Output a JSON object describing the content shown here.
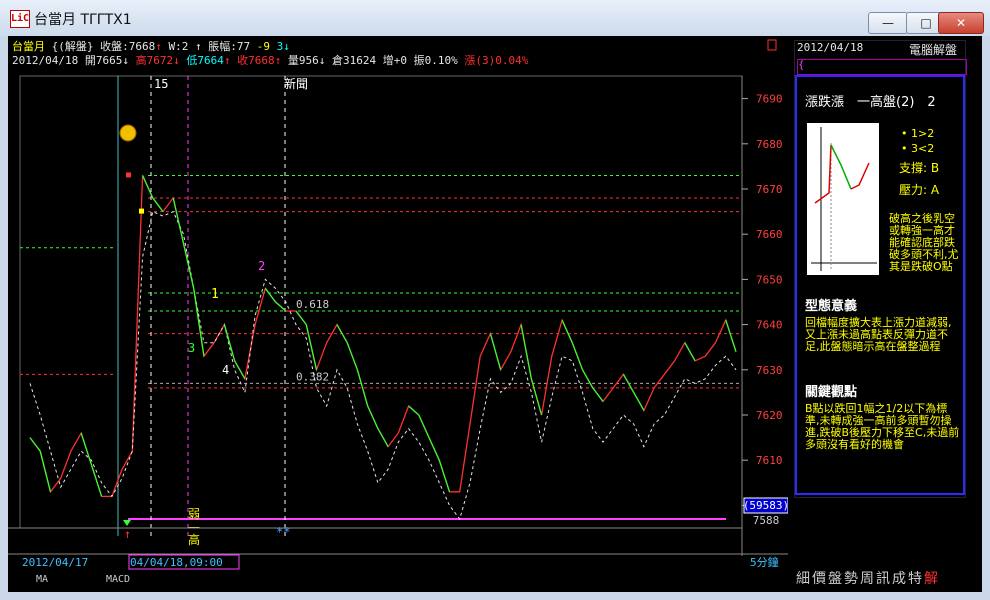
{
  "window": {
    "title": "台當月 TΓΓTX1",
    "icon_text": "LiC",
    "minimize_glyph": "—",
    "maximize_glyph": "□",
    "close_glyph": "✕"
  },
  "header": {
    "line1": {
      "name": "台當月",
      "mode": "{(解盤}",
      "close_label": "收盤:",
      "close_value": "7668",
      "arrow_up": "↑",
      "w_label": "W:",
      "w_value": "2",
      "amp_label": "↑ 脹幅:",
      "amp_value": "77",
      "change": "-9",
      "change_count": "3",
      "arrow_down": "↓"
    },
    "line2": {
      "date": "2012/04/18",
      "open": "開7665",
      "open_arrow": "↓",
      "high": "高7672",
      "high_arrow": "↓",
      "low": "低7664",
      "low_arrow": "↑",
      "close": "收7668",
      "close_arrow": "↑",
      "vol": "量956",
      "vol_arrow": "↓",
      "oi": "倉31624",
      "inc": "增+0",
      "amp": "振0.10%",
      "rise": "漲(3)0.04%"
    }
  },
  "chart_data": {
    "type": "line",
    "ylim": [
      7595,
      7695
    ],
    "yticks": [
      7600,
      7610,
      7620,
      7630,
      7640,
      7650,
      7660,
      7670,
      7680,
      7690
    ],
    "xlabels": {
      "left_date": "2012/04/17",
      "cursor_date": "04/04/18,09:00",
      "period": "5分鐘"
    },
    "series": [
      {
        "color": "#ff3030",
        "values": [
          7615,
          7612,
          7603,
          7606,
          7612,
          7616,
          7609,
          7602,
          7602,
          7608,
          7612,
          7673,
          7668,
          7665,
          7668,
          7658,
          7648,
          7633,
          7636,
          7640,
          7632,
          7628,
          7640,
          7648,
          7645,
          7643,
          7643,
          7640,
          7630,
          7636,
          7640,
          7636,
          7630,
          7622,
          7617,
          7613,
          7616,
          7622,
          7620,
          7615,
          7610,
          7603,
          7603,
          7618,
          7633,
          7638,
          7630,
          7634,
          7640,
          7628,
          7620,
          7633,
          7641,
          7636,
          7630,
          7626,
          7623,
          7626,
          7629,
          7625,
          7621,
          7626,
          7629,
          7632,
          7636,
          7632,
          7633,
          7636,
          7641,
          7634
        ]
      },
      {
        "color": "#e6e6e6",
        "dashed": true,
        "values": [
          7627,
          7620,
          7612,
          7604,
          7608,
          7612,
          7610,
          7605,
          7602,
          7606,
          7612,
          7655,
          7665,
          7664,
          7665,
          7660,
          7648,
          7636,
          7636,
          7640,
          7630,
          7625,
          7642,
          7650,
          7648,
          7645,
          7640,
          7637,
          7626,
          7622,
          7630,
          7626,
          7618,
          7612,
          7605,
          7608,
          7614,
          7617,
          7614,
          7610,
          7605,
          7600,
          7597,
          7605,
          7617,
          7628,
          7625,
          7627,
          7633,
          7625,
          7614,
          7624,
          7633,
          7632,
          7625,
          7617,
          7614,
          7617,
          7620,
          7618,
          7613,
          7618,
          7620,
          7624,
          7628,
          7627,
          7628,
          7631,
          7633,
          7630
        ]
      }
    ],
    "levels": [
      {
        "label": "0.618",
        "value": 7643
      },
      {
        "label": "0.382",
        "value": 7627
      }
    ],
    "tags": {
      "t15": "15",
      "tNews": "新聞",
      "t1": "1",
      "t2": "2",
      "t3": "3",
      "t4": "4",
      "tWeak": "弱一高",
      "tStars": "**"
    },
    "price_box_1": "(59583)",
    "price_box_2": "7588"
  },
  "right_panel": {
    "date": "2012/04/18",
    "title": "電腦解盤",
    "header_glyph": "{",
    "pattern_name": "漲跌漲　一高盤(2)　2",
    "legend_items": [
      "1>2",
      "3<2"
    ],
    "support": "支撐: B",
    "resistance": "壓力: A",
    "desc1": "破高之後乳空或轉強一高才能確認底部跌破多頭不利,尤其是跌破O點",
    "section1": "型態意義",
    "desc2": "回檔幅度擴大表上漲力道減弱,又上漲未過高點表反彈力道不足,此盤態暗示高在盤整過程",
    "section2": "關鍵觀點",
    "desc3": "B點以跌回1幅之1/2以下為標準,未轉成強一高前多頭暫勿操進,跌破B後壓力下移至C,未過前多頭沒有看好的機會",
    "tabs": [
      "細",
      "價",
      "盤",
      "勢",
      "周",
      "訊",
      "成",
      "特",
      "解"
    ]
  },
  "bottom_tabs": [
    "MA",
    "MACD"
  ]
}
